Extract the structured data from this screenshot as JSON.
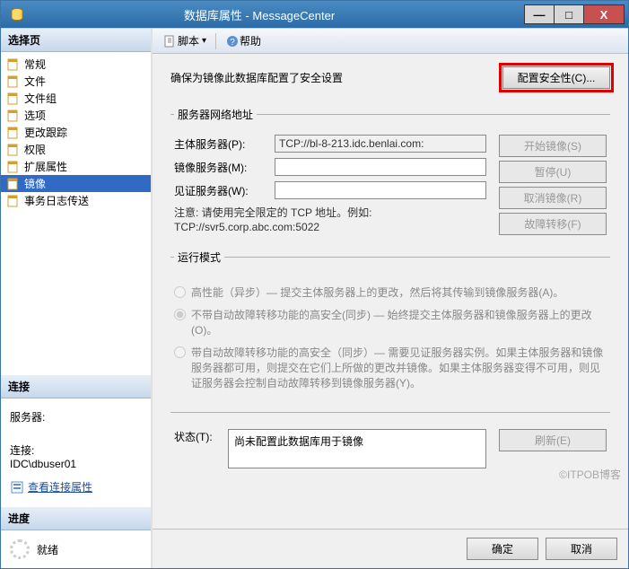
{
  "titlebar": {
    "text": "数据库属性 - MessageCenter"
  },
  "winbtn": {
    "min": "—",
    "max": "□",
    "close": "X"
  },
  "left": {
    "select_hd": "选择页",
    "items": [
      {
        "label": "常规"
      },
      {
        "label": "文件"
      },
      {
        "label": "文件组"
      },
      {
        "label": "选项"
      },
      {
        "label": "更改跟踪"
      },
      {
        "label": "权限"
      },
      {
        "label": "扩展属性"
      },
      {
        "label": "镜像"
      },
      {
        "label": "事务日志传送"
      }
    ],
    "conn_hd": "连接",
    "server_label": "服务器:",
    "server_value": "",
    "conn_label": "连接:",
    "conn_value": "IDC\\dbuser01",
    "view_link": "查看连接属性",
    "prog_hd": "进度",
    "prog_status": "就绪"
  },
  "toolbar": {
    "script": "脚本",
    "help": "帮助"
  },
  "content": {
    "sec_prompt": "确保为镜像此数据库配置了安全设置",
    "sec_btn": "配置安全性(C)...",
    "net_legend": "服务器网络地址",
    "principal_label": "主体服务器(P):",
    "principal_value": "TCP://bl-8-213.idc.benlai.com:",
    "mirror_label": "镜像服务器(M):",
    "mirror_value": "",
    "witness_label": "见证服务器(W):",
    "witness_value": "",
    "btn_start": "开始镜像(S)",
    "btn_pause": "暂停(U)",
    "btn_cancel_mirror": "取消镜像(R)",
    "btn_failover": "故障转移(F)",
    "note": "注意: 请使用完全限定的 TCP 地址。例如: TCP://svr5.corp.abc.com:5022",
    "mode_legend": "运行模式",
    "mode_opt1": "高性能（异步）— 提交主体服务器上的更改，然后将其传输到镜像服务器(A)。",
    "mode_opt2": "不带自动故障转移功能的高安全(同步) — 始终提交主体服务器和镜像服务器上的更改(O)。",
    "mode_opt3": "带自动故障转移功能的高安全（同步）— 需要见证服务器实例。如果主体服务器和镜像服务器都可用，则提交在它们上所做的更改并镜像。如果主体服务器变得不可用，则见证服务器会控制自动故障转移到镜像服务器(Y)。",
    "state_label": "状态(T):",
    "state_value": "尚未配置此数据库用于镜像",
    "btn_refresh": "刷新(E)"
  },
  "footer": {
    "ok": "确定",
    "cancel": "取消"
  },
  "watermark": "©ITPOB博客"
}
